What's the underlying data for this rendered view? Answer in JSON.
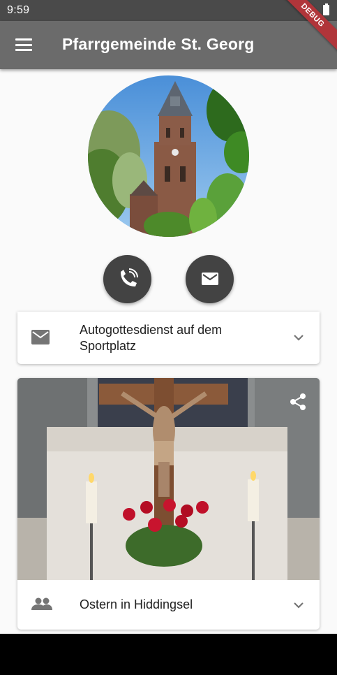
{
  "status_bar": {
    "time": "9:59"
  },
  "debug_banner": "DEBUG",
  "app_bar": {
    "title": "Pfarrgemeinde St. Georg"
  },
  "icons": {
    "menu": "menu-icon",
    "phone": "phone-icon",
    "mail": "mail-icon",
    "share": "share-icon",
    "group": "group-icon",
    "chevron": "chevron-down-icon"
  },
  "cards": [
    {
      "label": "Autogottesdienst auf dem Sportplatz",
      "icon": "mail-icon"
    },
    {
      "label": "Ostern in Hiddingsel",
      "icon": "group-icon"
    }
  ],
  "colors": {
    "app_bar": "#6b6b6b",
    "status_bar": "#4a4a4a",
    "action_button": "#434343",
    "debug": "#b0353a"
  }
}
